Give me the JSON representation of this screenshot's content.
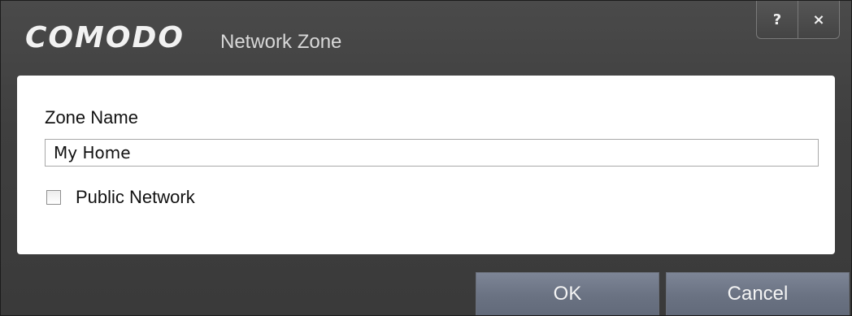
{
  "window": {
    "brand": "COMODO",
    "title": "Network Zone",
    "help_label": "?",
    "close_label": "×"
  },
  "form": {
    "zone_name_label": "Zone Name",
    "zone_name_value": "My Home",
    "public_network_label": "Public Network",
    "public_network_checked": false
  },
  "footer": {
    "ok_label": "OK",
    "cancel_label": "Cancel"
  },
  "colors": {
    "title_bar_bg": "#434343",
    "button_bg": "#6e7686",
    "panel_bg": "#ffffff"
  }
}
